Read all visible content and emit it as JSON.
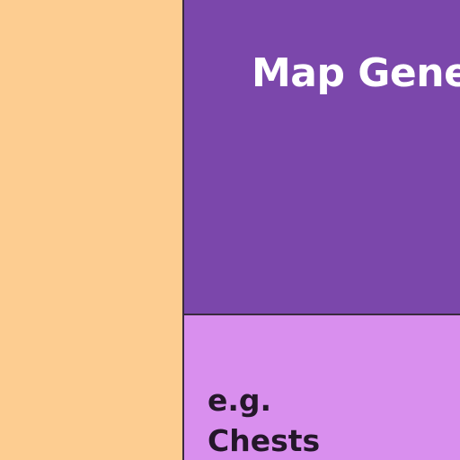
{
  "diagram": {
    "top_right_panel": {
      "heading": "Map Gene"
    },
    "bottom_right_panel": {
      "line_1": "e.g.",
      "line_2": "Chests"
    },
    "colors": {
      "left_panel": "#fdcd91",
      "top_right_panel": "#7b47ab",
      "bottom_right_panel": "#d98fee",
      "divider": "#3a2a3e",
      "heading_text": "#ffffff",
      "body_text": "#24172a"
    }
  }
}
